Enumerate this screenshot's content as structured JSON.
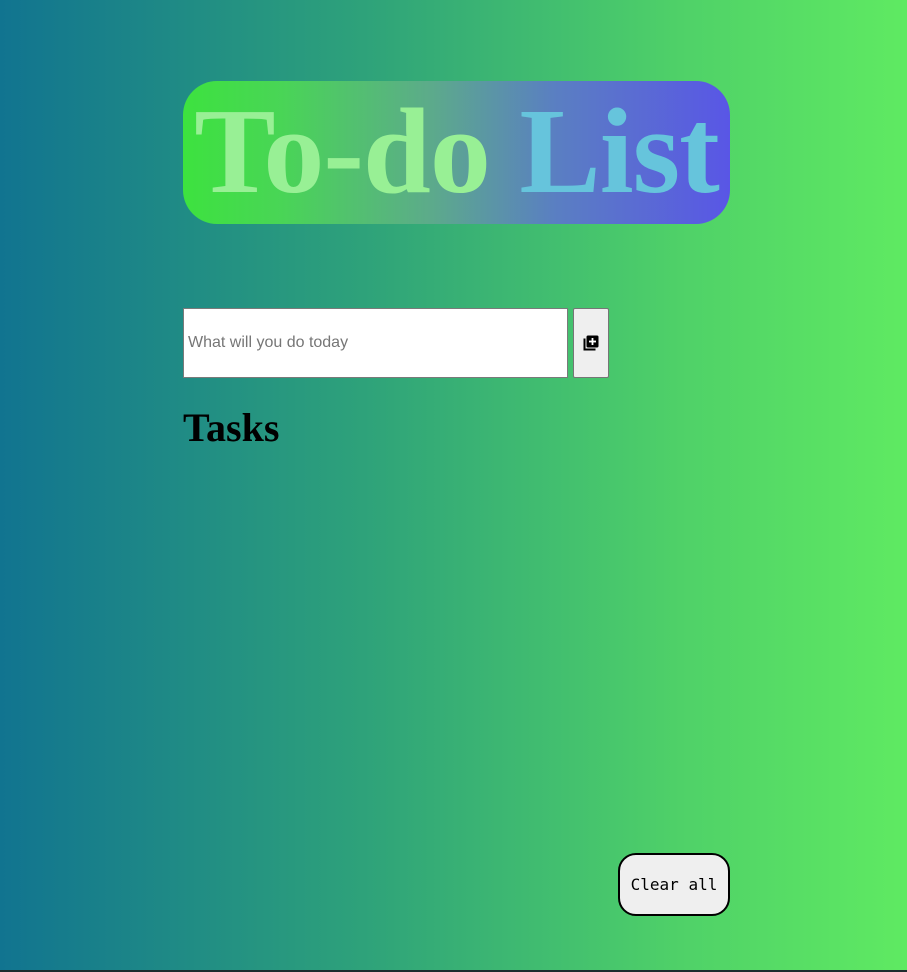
{
  "header": {
    "title_part_1": "To-do",
    "title_part_2": "List"
  },
  "task_form": {
    "input_value": "",
    "input_placeholder": "What will you do today",
    "add_button_icon": "library-add-icon"
  },
  "tasks_section": {
    "heading": "Tasks",
    "items": []
  },
  "footer": {
    "clear_button_label": "Clear all"
  },
  "colors": {
    "title_part_1": "#98f095",
    "title_part_2": "#66c4dc",
    "background_left": "#117490",
    "background_right": "#5fea62",
    "banner_left": "#3de23f",
    "banner_right": "#5956e6"
  }
}
